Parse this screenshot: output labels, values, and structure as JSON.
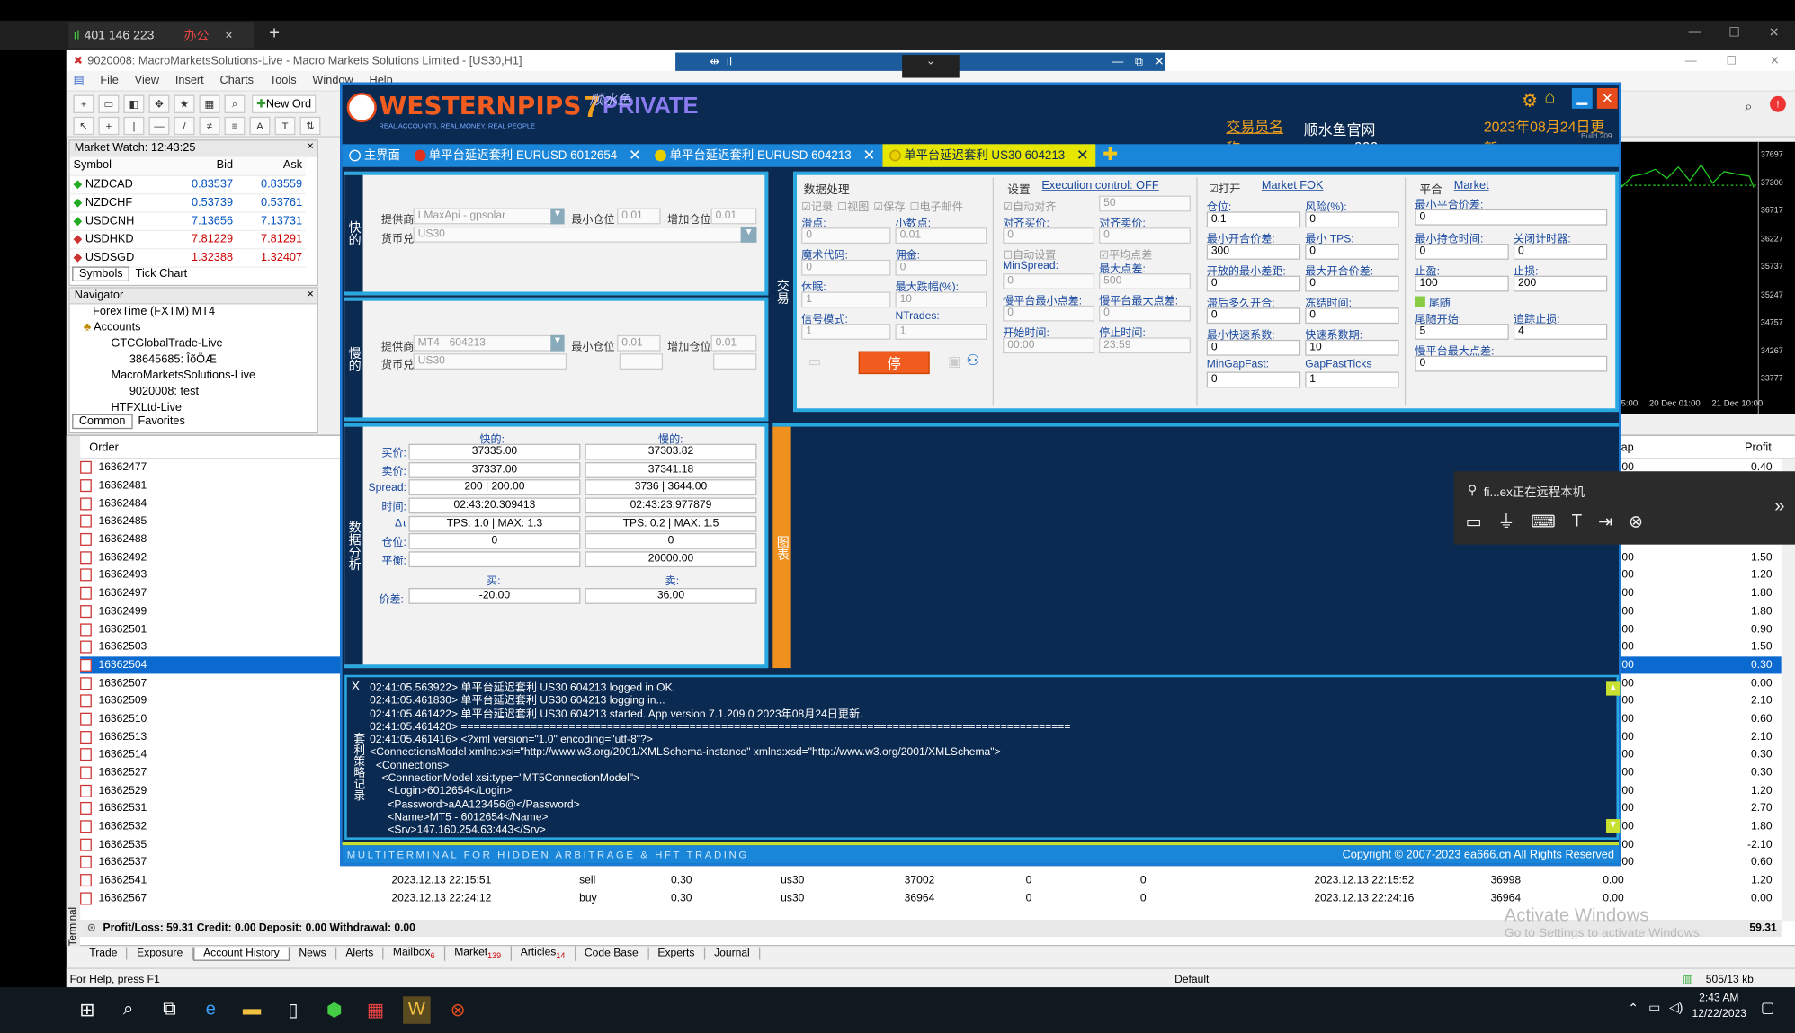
{
  "remote_tab": {
    "signal": "401 146 223",
    "label": "办公",
    "close": "×",
    "add": "+"
  },
  "mt4": {
    "title": "9020008: MacroMarketsSolutions-Live - Macro Markets Solutions Limited - [US30,H1]",
    "menu": [
      "File",
      "View",
      "Insert",
      "Charts",
      "Tools",
      "Window",
      "Help"
    ],
    "new_order": "New Ord",
    "market_watch": {
      "title": "Market Watch: 12:43:25",
      "cols": [
        "Symbol",
        "Bid",
        "Ask"
      ],
      "rows": [
        [
          "NZDCAD",
          "0.83537",
          "0.83559"
        ],
        [
          "NZDCHF",
          "0.53739",
          "0.53761"
        ],
        [
          "USDCNH",
          "7.13656",
          "7.13731"
        ],
        [
          "USDHKD",
          "7.81229",
          "7.81291"
        ],
        [
          "USDSGD",
          "1.32388",
          "1.32407"
        ]
      ],
      "tabs": [
        "Symbols",
        "Tick Chart"
      ]
    },
    "navigator": {
      "title": "Navigator",
      "root": "ForexTime (FXTM) MT4",
      "accounts": "Accounts",
      "items": [
        "GTCGlobalTrade-Live",
        "38645685: ÎõÖÆ",
        "MacroMarketsSolutions-Live",
        "9020008: test",
        "HTFXLtd-Live"
      ],
      "tabs": [
        "Common",
        "Favorites"
      ]
    },
    "chart_prices": [
      "37697",
      "37300",
      "36717",
      "36227",
      "35737",
      "35247",
      "34757",
      "34267",
      "33777"
    ],
    "chart_dates": [
      "5:00",
      "20 Dec 01:00",
      "21 Dec 10:00"
    ],
    "orders": {
      "header": "Order",
      "profit_header": "Profit",
      "ap_header": "ap",
      "ids": [
        "16362477",
        "16362481",
        "16362484",
        "16362485",
        "16362488",
        "16362492",
        "16362493",
        "16362497",
        "16362499",
        "16362501",
        "16362503",
        "16362504",
        "16362507",
        "16362509",
        "16362510",
        "16362513",
        "16362514",
        "16362527",
        "16362529",
        "16362531",
        "16362532",
        "16362535",
        "16362537",
        "16362541",
        "16362567"
      ],
      "profits": [
        "0.40",
        "",
        "",
        "",
        "",
        "1.50",
        "1.20",
        "1.80",
        "1.80",
        "0.90",
        "1.50",
        "0.30",
        "0.00",
        "2.10",
        "0.60",
        "2.10",
        "0.30",
        "0.30",
        "1.20",
        "2.70",
        "1.80",
        "-2.10",
        "0.60",
        "1.20",
        "0.00"
      ],
      "ap": [
        ".00",
        ".00",
        ".00",
        ".00",
        ".00",
        ".00",
        ".00",
        ".00",
        ".00",
        ".00",
        ".00",
        ".00",
        ".00",
        ".00",
        ".00",
        ".00",
        ".00",
        ".00",
        ".00",
        ".00",
        ".00",
        ".00",
        ".00",
        ".00",
        ".00"
      ],
      "full_rows": [
        {
          "id": "16362541",
          "open": "2023.12.13 22:15:51",
          "type": "sell",
          "size": "0.30",
          "sym": "us30",
          "price": "37002",
          "sl": "0",
          "tp": "0",
          "close": "2023.12.13 22:15:52",
          "cprice": "36998",
          "comm": "0.00",
          "profit": "1.20"
        },
        {
          "id": "16362567",
          "open": "2023.12.13 22:24:12",
          "type": "buy",
          "size": "0.30",
          "sym": "us30",
          "price": "36964",
          "sl": "0",
          "tp": "0",
          "close": "2023.12.13 22:24:16",
          "cprice": "36964",
          "comm": "0.00",
          "profit": "0.00"
        }
      ],
      "summary": "Profit/Loss: 59.31  Credit: 0.00  Deposit: 0.00  Withdrawal: 0.00",
      "summary_total": "59.31"
    },
    "terminal_tabs": [
      "Trade",
      "Exposure",
      "Account History",
      "News",
      "Alerts",
      "Mailbox",
      "Market",
      "Articles",
      "Code Base",
      "Experts",
      "Journal"
    ],
    "badges": {
      "mailbox": "6",
      "market": "139",
      "articles": "14"
    },
    "status": {
      "help": "For Help, press F1",
      "profile": "Default",
      "traffic": "505/13 kb"
    },
    "watermark": [
      "Activate Windows",
      "Go to Settings to activate Windows."
    ],
    "terminal_label": "Terminal"
  },
  "remote_toolbar": {
    "title": "fi...ex正在远程本机"
  },
  "ea": {
    "logo": "WESTERNPIPS",
    "logo_sub": "REAL ACCOUNTS, REAL MONEY, REAL PEOPLE",
    "logo_badge": "PRIVATE",
    "logo_cn": "顺水鱼",
    "logo_num": "7",
    "trader_label": "交易员名称:",
    "trader_name": "顺水鱼官网 www.ea666.cn",
    "update": "2023年08月24日更新",
    "build": "Build 209",
    "tabs": [
      {
        "label": "主界面",
        "color": "#1a86d9"
      },
      {
        "label": "单平台延迟套利 EURUSD 6012654",
        "color": "#e0301e"
      },
      {
        "label": "单平台延迟套利 EURUSD 604213",
        "color": "#e8d000"
      },
      {
        "label": "单平台延迟套利 US30 604213",
        "color": "#e8d000"
      }
    ],
    "fast": {
      "label": "快的",
      "provider_label": "提供商:",
      "provider": "LMaxApi - gpsolar",
      "min_lot_label": "最小仓位",
      "min_lot": "0.01",
      "inc_label": "增加仓位",
      "inc": "0.01",
      "pair_label": "货币兑:",
      "pair": "US30"
    },
    "slow": {
      "label": "慢的",
      "provider_label": "提供商:",
      "provider": "MT4 - 604213",
      "min_lot_label": "最小仓位",
      "min_lot": "0.01",
      "inc_label": "增加仓位",
      "inc": "0.01",
      "pair_label": "货币兑:",
      "pair": "US30"
    },
    "trade_label": "交易",
    "data_proc": {
      "title": "数据处理",
      "chk": [
        "记录",
        "视图",
        "保存",
        "电子邮件"
      ],
      "slip_label": "滑点:",
      "slip": "0",
      "dec_label": "小数点:",
      "dec": "0.01",
      "magic_label": "魔术代码:",
      "magic": "0",
      "comm_label": "佣金:",
      "comm": "0",
      "rest_label": "休眠:",
      "rest": "1",
      "maxjump_label": "最大跌幅(%):",
      "maxjump": "10",
      "signal_label": "信号模式:",
      "signal": "1",
      "ntrades_label": "NTrades:",
      "ntrades": "1",
      "stop": "停"
    },
    "settings": {
      "title": "设置",
      "exec": "Execution control: OFF",
      "auto_hedge": "自动对齐",
      "auto_val": "50",
      "hedge_buy_label": "对齐买价:",
      "hedge_buy": "0",
      "hedge_sell_label": "对齐卖价:",
      "hedge_sell": "0",
      "auto_set": "自动设置",
      "avg_pts": "平均点差",
      "minspread_label": "MinSpread:",
      "minspread": "0",
      "maxpts_label": "最大点差:",
      "maxpts": "500",
      "slow_min_label": "慢平台最小点差:",
      "slow_min": "0",
      "slow_max_label": "慢平台最大点差:",
      "slow_max": "0",
      "start_label": "开始时间:",
      "start": "00:00",
      "stop_label": "停止时间:",
      "stop": "23:59"
    },
    "open": {
      "title": "打开",
      "market": "Market FOK",
      "lot_label": "仓位:",
      "lot": "0.1",
      "risk_label": "风险(%):",
      "risk": "0",
      "min_open_label": "最小开合价差:",
      "min_open": "300",
      "min_tps_label": "最小 TPS:",
      "min_tps": "0",
      "min_diff_label": "开放的最小差距:",
      "min_diff": "0",
      "max_open_label": "最大开合价差:",
      "max_open": "0",
      "delay_label": "滞后多久开合:",
      "delay": "0",
      "freeze_label": "冻结时间:",
      "freeze": "0",
      "min_fast_label": "最小快速系数:",
      "min_fast": "0",
      "fast_coef_label": "快速系数期:",
      "fast_coef": "10",
      "mingap_label": "MinGapFast:",
      "mingap": "0",
      "gapticks_label": "GapFastTicks",
      "gapticks": "1"
    },
    "close": {
      "title": "平合",
      "market": "Market",
      "min_close_label": "最小平合价差:",
      "min_close": "0",
      "min_hold_label": "最小持仓时间:",
      "min_hold": "0",
      "close_timer_label": "关闭计时器:",
      "close_timer": "0",
      "tp_label": "止盈:",
      "tp": "100",
      "sl_label": "止损:",
      "sl": "200",
      "trail": "尾随",
      "trail_start_label": "尾随开始:",
      "trail_start": "5",
      "trail_stop_label": "追踪止损:",
      "trail_stop": "4",
      "slow_max_label": "慢平台最大点差:",
      "slow_max": "0"
    },
    "analysis": {
      "label": "数据分析",
      "fast_h": "快的:",
      "slow_h": "慢的:",
      "rows": [
        [
          "买价:",
          "37335.00",
          "37303.82"
        ],
        [
          "卖价:",
          "37337.00",
          "37341.18"
        ],
        [
          "Spread:",
          "200 | 200.00",
          "3736 | 3644.00"
        ],
        [
          "时间:",
          "02:43:20.309413",
          "02:43:23.977879"
        ],
        [
          "Δτ",
          "TPS: 1.0 | MAX: 1.3",
          "TPS: 0.2 | MAX: 1.5"
        ],
        [
          "仓位:",
          "0",
          "0"
        ],
        [
          "平衡:",
          "",
          "20000.00"
        ]
      ],
      "buy_h": "买:",
      "sell_h": "卖:",
      "diff_label": "价差:",
      "buy": "-20.00",
      "sell": "36.00"
    },
    "chart_label": "图表",
    "log_label": "套利策略记录",
    "log": [
      "02:41:05.563922> 单平台延迟套利 US30 604213 logged in OK.",
      "02:41:05.461830> 单平台延迟套利 US30 604213 logging in...",
      "02:41:05.461422> 单平台延迟套利 US30 604213 started. App version 7.1.209.0 2023年08月24日更新.",
      "02:41:05.461420> ================================================================================================",
      "02:41:05.461416> <?xml version=\"1.0\" encoding=\"utf-8\"?>",
      "<ConnectionsModel xmlns:xsi=\"http://www.w3.org/2001/XMLSchema-instance\" xmlns:xsd=\"http://www.w3.org/2001/XMLSchema\">",
      "  <Connections>",
      "    <ConnectionModel xsi:type=\"MT5ConnectionModel\">",
      "      <Login>6012654</Login>",
      "      <Password>aAA123456@</Password>",
      "      <Name>MT5 - 6012654</Name>",
      "      <Srv>147.160.254.63:443</Srv>"
    ],
    "footer_left": "MULTITERMINAL  FOR HIDDEN ARBITRAGE & HFT TRADING",
    "footer_right": "Copyright © 2007-2023     ea666.cn   All Rights Reserved"
  },
  "taskbar": {
    "time": "2:43 AM",
    "date": "12/22/2023"
  }
}
